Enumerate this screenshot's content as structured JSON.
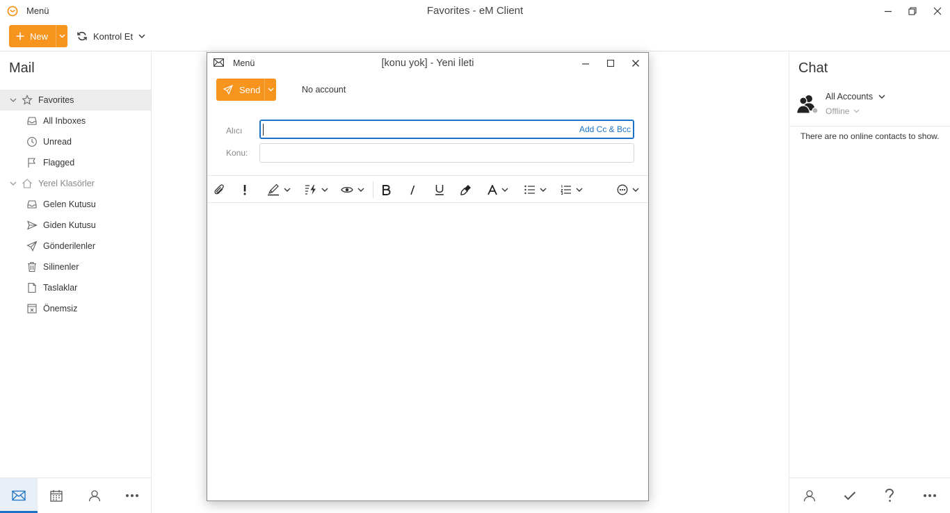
{
  "app": {
    "menu_label": "Menü",
    "window_title": "Favorites - eM Client",
    "accent_color": "#f7941d",
    "link_color": "#1a73c8"
  },
  "toolbar": {
    "new_label": "New",
    "sync_label": "Kontrol Et"
  },
  "sidebar": {
    "title": "Mail",
    "groups": [
      {
        "label": "Favorites",
        "icon": "star-icon",
        "items": [
          {
            "label": "All Inboxes",
            "icon": "inbox-icon"
          },
          {
            "label": "Unread",
            "icon": "clock-icon"
          },
          {
            "label": "Flagged",
            "icon": "flag-icon"
          }
        ]
      },
      {
        "label": "Yerel Klasörler",
        "icon": "home-icon",
        "items": [
          {
            "label": "Gelen Kutusu",
            "icon": "inbox-icon"
          },
          {
            "label": "Giden Kutusu",
            "icon": "outbox-icon"
          },
          {
            "label": "Gönderilenler",
            "icon": "sent-icon"
          },
          {
            "label": "Silinenler",
            "icon": "trash-icon"
          },
          {
            "label": "Taslaklar",
            "icon": "draft-icon"
          },
          {
            "label": "Önemsiz",
            "icon": "junk-icon"
          }
        ]
      }
    ],
    "bottom_nav": [
      "mail-icon",
      "calendar-icon",
      "contacts-icon",
      "more-icon"
    ]
  },
  "chat": {
    "title": "Chat",
    "account_label": "All Accounts",
    "status": "Offline",
    "empty_text": "There are no online contacts to show.",
    "bottom_nav": [
      "contact-icon",
      "tasks-icon",
      "help-icon",
      "more-icon"
    ]
  },
  "compose": {
    "menu_label": "Menü",
    "title": "[konu yok] - Yeni İleti",
    "send_label": "Send",
    "account_label": "No account",
    "to_label": "Alıcı",
    "to_value": "",
    "add_cc_label": "Add Cc & Bcc",
    "subject_label": "Konu:",
    "subject_value": "",
    "format_tools": [
      "attach-icon",
      "priority-icon",
      "highlight-icon",
      "quick-text-icon",
      "view-icon",
      "bold-icon",
      "italic-icon",
      "underline-icon",
      "format-painter-icon",
      "font-icon",
      "bullet-list-icon",
      "numbered-list-icon",
      "emoji-icon"
    ]
  }
}
